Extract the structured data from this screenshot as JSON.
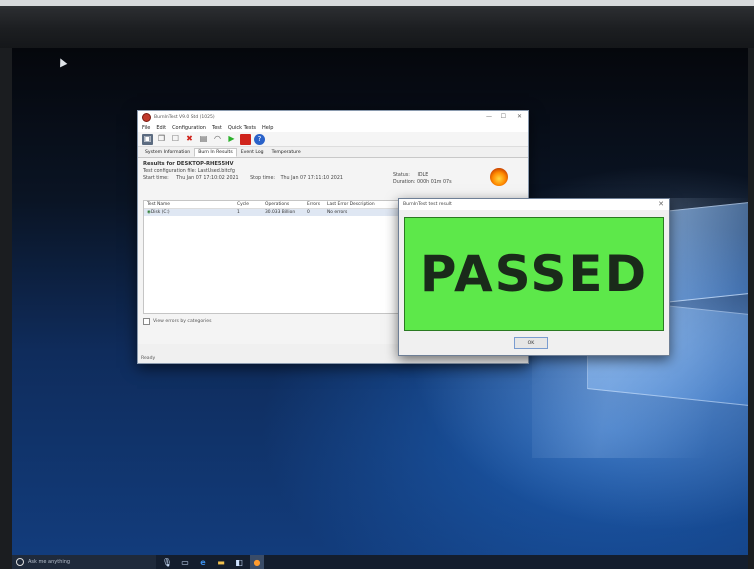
{
  "main_window": {
    "title": "BurnInTest V9.0 Std (1025)",
    "controls": {
      "min": "—",
      "max": "☐",
      "close": "✕"
    },
    "menu": [
      "File",
      "Edit",
      "Configuration",
      "Test",
      "Quick Tests",
      "Help"
    ],
    "tabs": [
      "System Information",
      "Burn In Results",
      "Event Log",
      "Temperature"
    ],
    "results_title": "Results for DESKTOP-RHE55HV",
    "config_line": "Test configuration file:  LastUsed.bitcfg",
    "start_label": "Start time:",
    "start_time": "Thu Jan 07 17:10:02 2021",
    "stop_label": "Stop time:",
    "stop_time": "Thu Jan 07 17:11:10 2021",
    "status_label": "Status:",
    "status_value": "IDLE",
    "duration_label": "Duration:",
    "duration_value": "000h 01m 07s",
    "table": {
      "headers": [
        "Test Name",
        "Cycle",
        "Operations",
        "Errors",
        "Last Error Description"
      ],
      "rows": [
        [
          "Disk (C:)",
          "1",
          "30.033 Billion",
          "0",
          "No errors"
        ]
      ]
    },
    "view_errors_label": "View errors by categories",
    "statusbar": "Ready"
  },
  "result_dialog": {
    "title": "BurnInTest test result",
    "close": "✕",
    "result": "PASSED",
    "ok_label": "OK",
    "result_color": "#5de84a"
  },
  "taskbar": {
    "search_placeholder": "Ask me anything",
    "icons": [
      "microphone-icon",
      "task-view-icon",
      "edge-icon",
      "file-explorer-icon",
      "store-icon",
      "burnin-icon"
    ]
  }
}
